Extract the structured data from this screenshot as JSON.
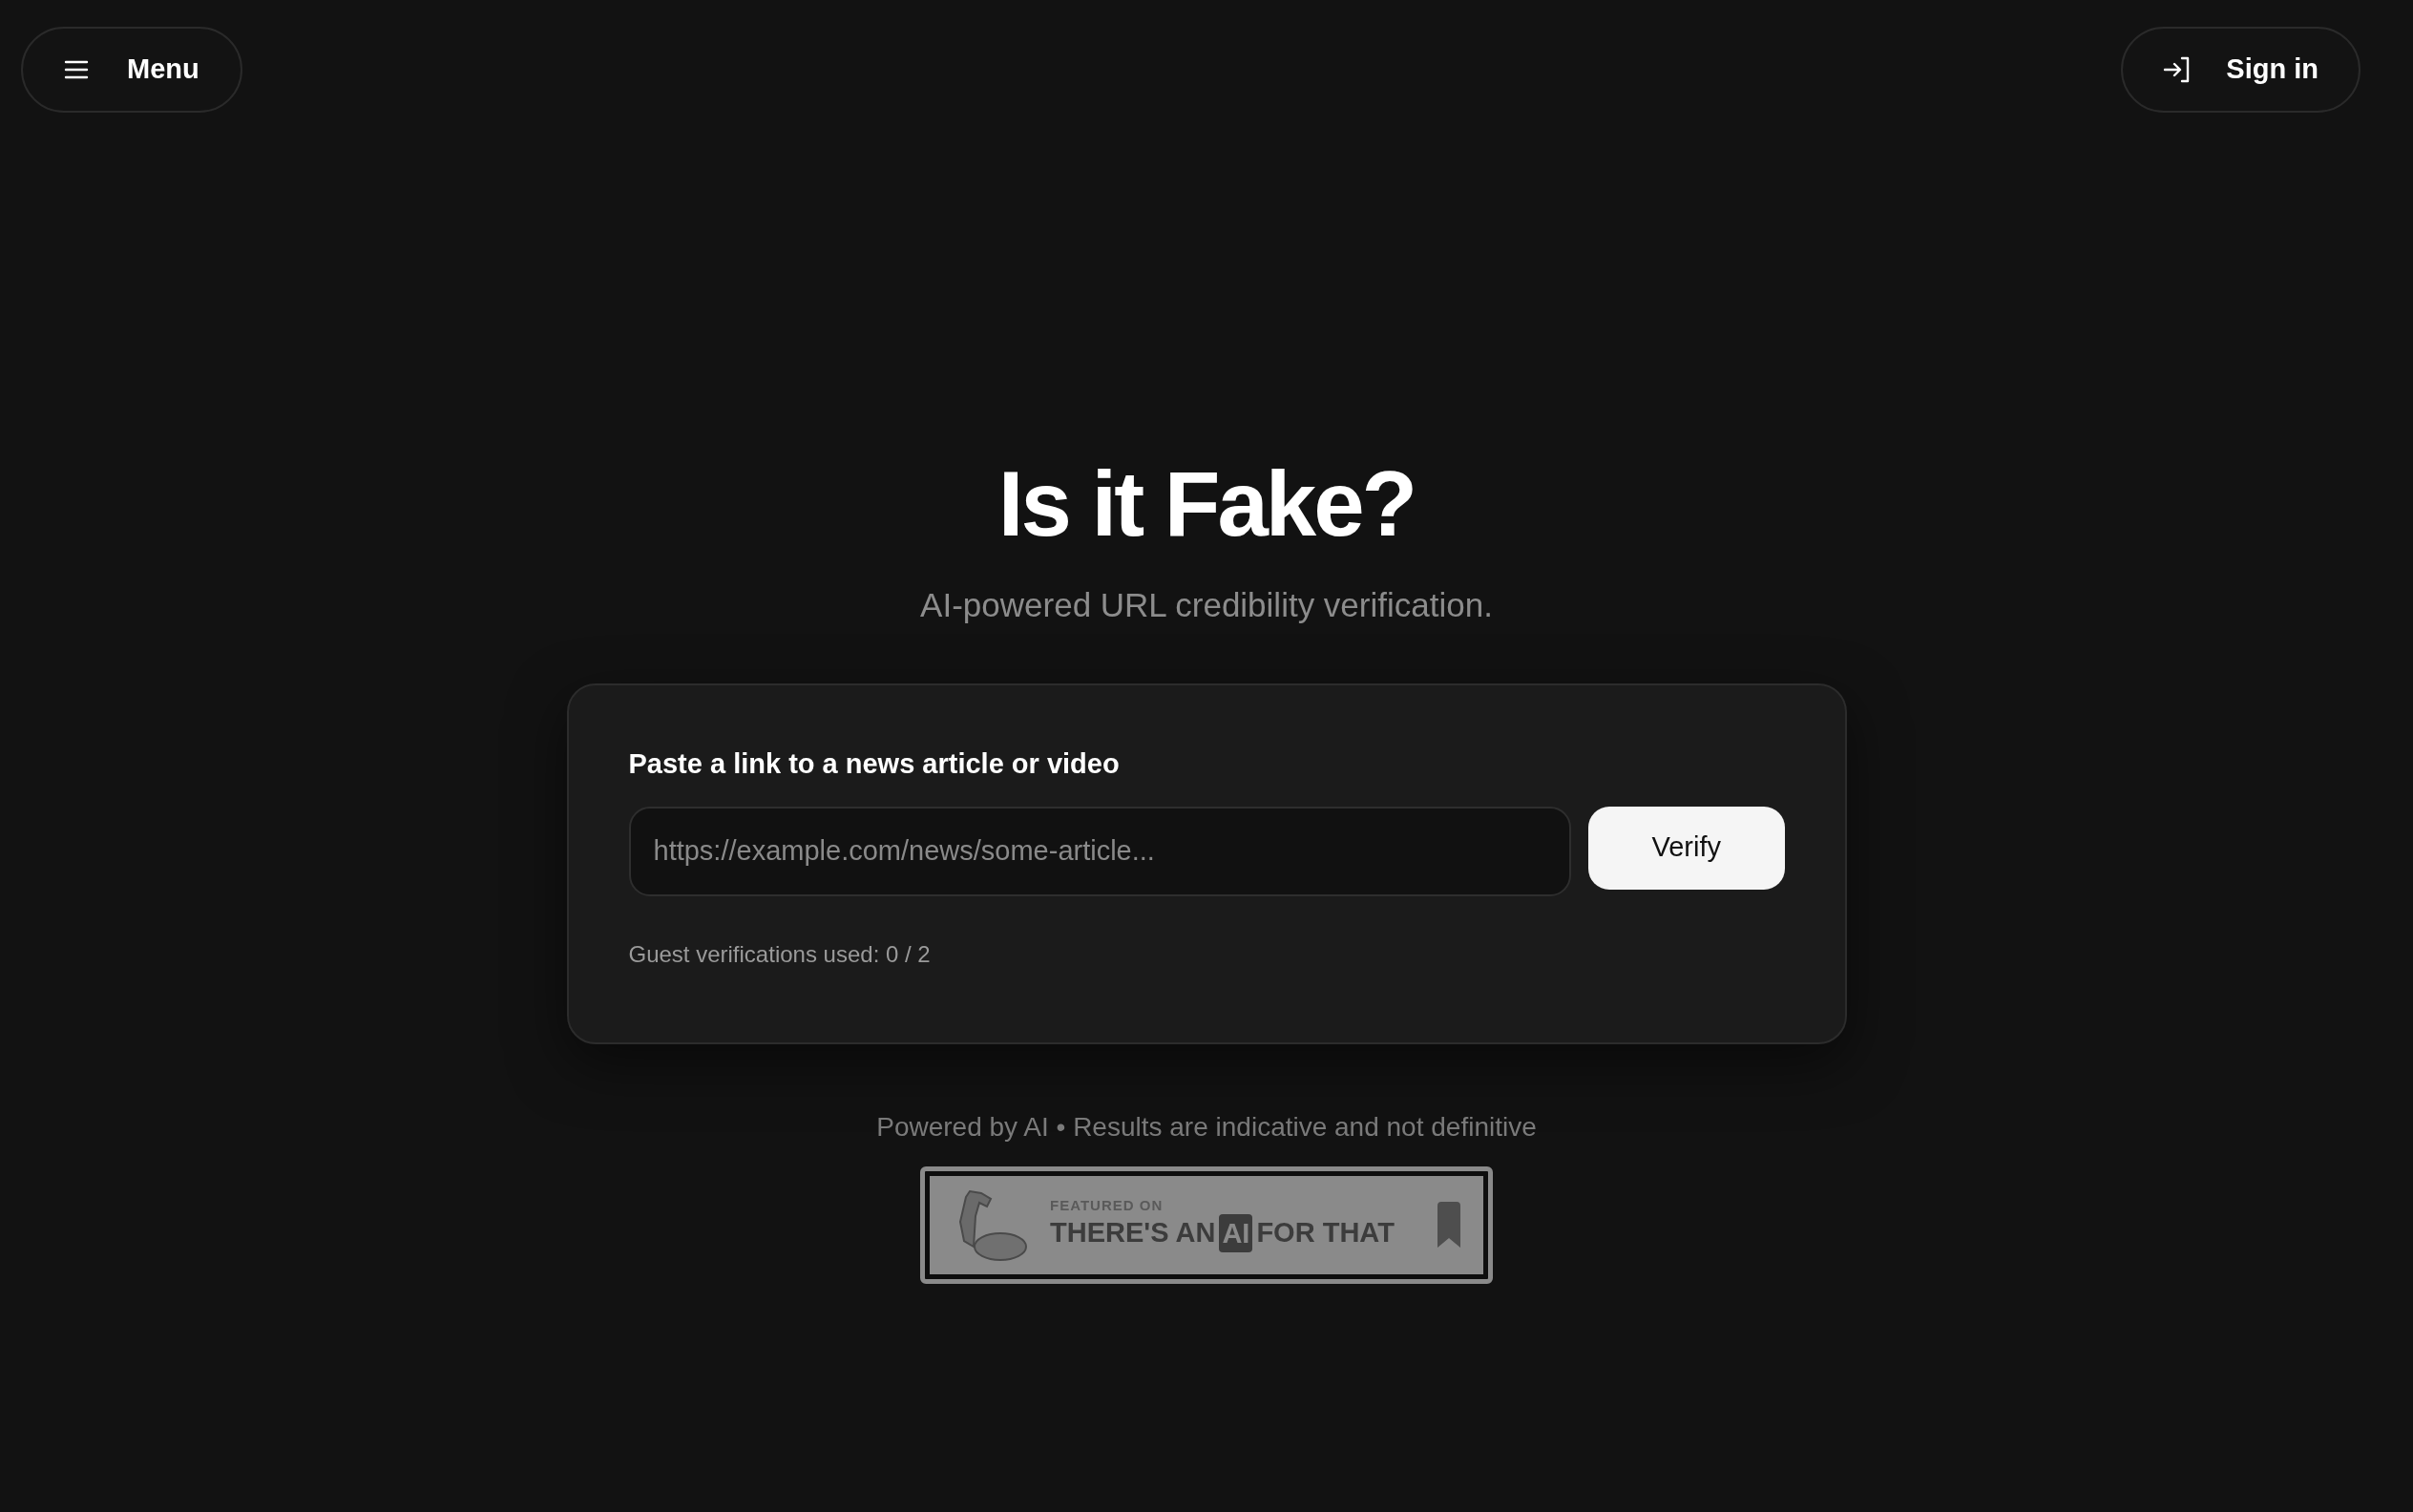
{
  "header": {
    "menu_button": "Menu",
    "sign_in_button": "Sign in"
  },
  "hero": {
    "title": "Is it Fake?",
    "subtitle": "AI-powered URL credibility verification."
  },
  "form": {
    "label": "Paste a link to a news article or video",
    "url_field": {
      "placeholder": "https://example.com/news/some-article..."
    },
    "submit_button": "Verify",
    "usage_note": "Guest verifications used: 0 / 2"
  },
  "footer": {
    "note": "Powered by AI • Results are indicative and not definitive",
    "badge": {
      "kicker": "FEATURED ON",
      "name_before": "THERE'S AN",
      "name_highlight": "AI",
      "name_after": "FOR THAT"
    }
  }
}
